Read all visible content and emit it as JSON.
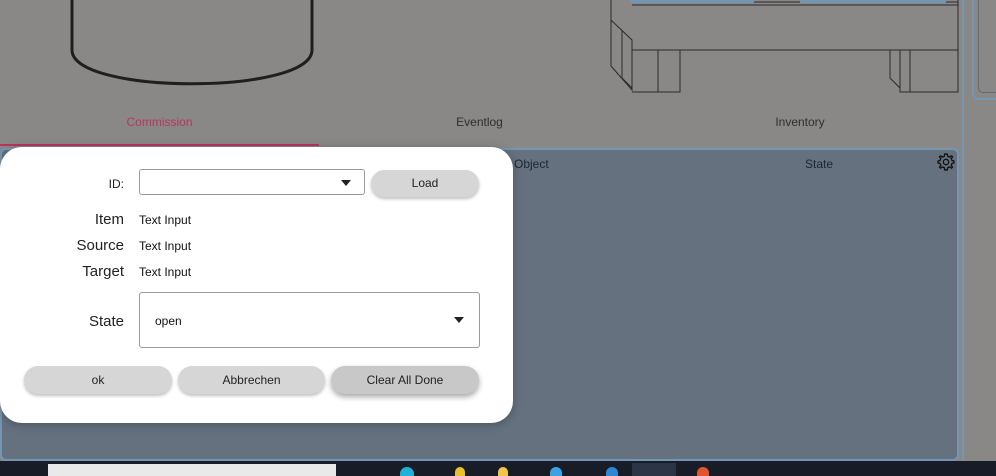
{
  "tabs": [
    {
      "label": "Commission",
      "active": true
    },
    {
      "label": "Eventlog",
      "active": false
    },
    {
      "label": "Inventory",
      "active": false
    }
  ],
  "grid": {
    "headers": [
      "Object",
      "State"
    ]
  },
  "icons": {
    "settings": "gear-icon",
    "dropdown": "chevron-down-icon"
  },
  "dialog": {
    "id_label": "ID:",
    "id_value": "",
    "load_button": "Load",
    "item_label": "Item",
    "item_value": "Text Input",
    "source_label": "Source",
    "source_value": "Text Input",
    "target_label": "Target",
    "target_value": "Text Input",
    "state_label": "State",
    "state_value": "open",
    "ok_button": "ok",
    "cancel_button": "Abbrechen",
    "clear_button": "Clear All Done"
  },
  "colors": {
    "accent": "#b5375f",
    "panel": "#65717f",
    "border": "#7596b3",
    "backdrop": "#8a8787",
    "button": "#d6d6d6"
  }
}
